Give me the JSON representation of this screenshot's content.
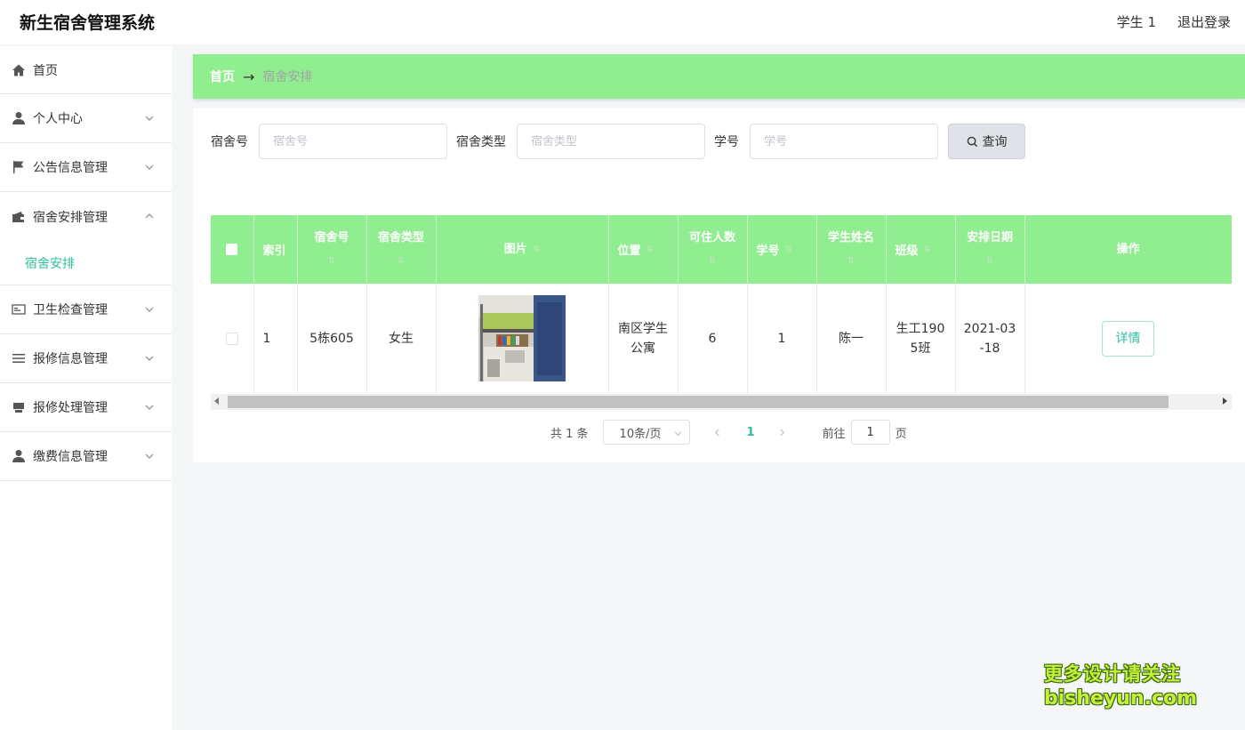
{
  "header": {
    "title": "新生宿舍管理系统",
    "user": "学生 1",
    "logout": "退出登录"
  },
  "sidebar": {
    "items": [
      {
        "label": "首页",
        "icon": "home-icon"
      },
      {
        "label": "个人中心",
        "icon": "user-icon"
      },
      {
        "label": "公告信息管理",
        "icon": "flag-icon"
      },
      {
        "label": "宿舍安排管理",
        "icon": "wallet-icon"
      },
      {
        "label": "卫生检查管理",
        "icon": "id-card-icon"
      },
      {
        "label": "报修信息管理",
        "icon": "list-icon"
      },
      {
        "label": "报修处理管理",
        "icon": "printer-icon"
      },
      {
        "label": "缴费信息管理",
        "icon": "user-icon"
      }
    ],
    "active_sub": "宿舍安排"
  },
  "breadcrumb": {
    "home": "首页",
    "arrow": "→",
    "current": "宿舍安排"
  },
  "search": {
    "dorm_no_label": "宿舍号",
    "dorm_no_placeholder": "宿舍号",
    "dorm_type_label": "宿舍类型",
    "dorm_type_placeholder": "宿舍类型",
    "student_no_label": "学号",
    "student_no_placeholder": "学号",
    "query_label": "查询"
  },
  "table": {
    "headers": {
      "index": "索引",
      "dorm_no": "宿舍号",
      "dorm_type": "宿舍类型",
      "image": "图片",
      "location": "位置",
      "capacity": "可住人数",
      "student_no": "学号",
      "student_name": "学生姓名",
      "class": "班级",
      "date": "安排日期",
      "actions": "操作"
    },
    "sort_glyph": "⇅",
    "rows": [
      {
        "index": "1",
        "dorm_no": "5栋605",
        "dorm_type": "女生",
        "location_1": "南区学生",
        "location_2": "公寓",
        "capacity": "6",
        "student_no": "1",
        "student_name": "陈一",
        "class_1": "生工190",
        "class_2": "5班",
        "date_1": "2021-03",
        "date_2": "-18",
        "detail_label": "详情"
      }
    ]
  },
  "pagination": {
    "total": "共 1 条",
    "page_size": "10条/页",
    "current_page": "1",
    "goto_label": "前往",
    "goto_value": "1",
    "page_suffix": "页"
  },
  "watermark": {
    "line1": "更多设计请关注",
    "line2": "bisheyun.com"
  },
  "colors": {
    "accent": "#90ee90",
    "active": "#2fbfa0"
  }
}
